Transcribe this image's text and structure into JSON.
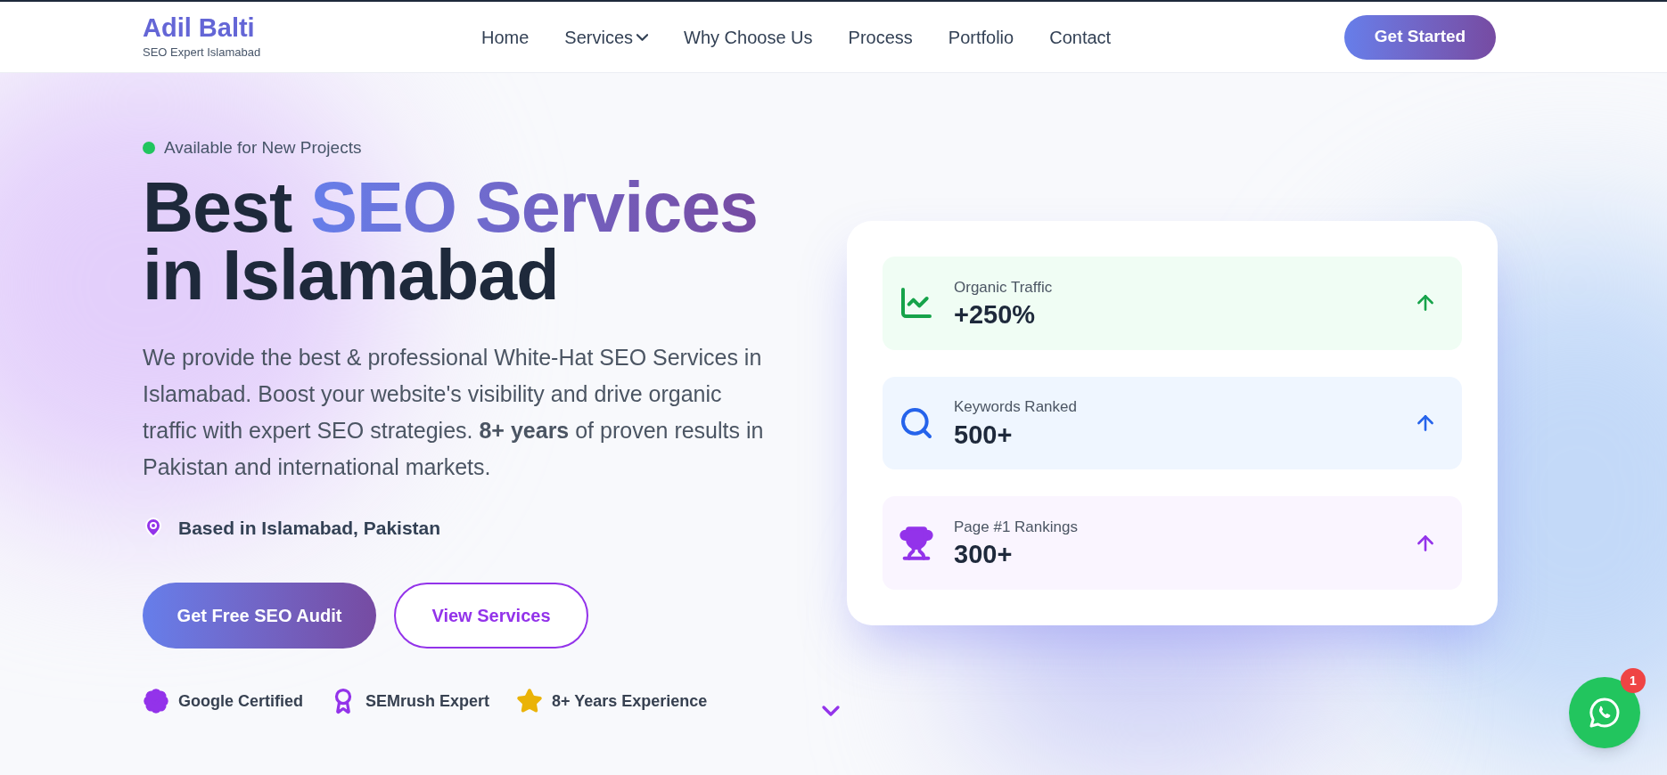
{
  "brand": {
    "name": "Adil Balti",
    "tagline": "SEO Expert Islamabad"
  },
  "nav": [
    {
      "label": "Home",
      "has_menu": false
    },
    {
      "label": "Services",
      "has_menu": true
    },
    {
      "label": "Why Choose Us",
      "has_menu": false
    },
    {
      "label": "Process",
      "has_menu": false
    },
    {
      "label": "Portfolio",
      "has_menu": false
    },
    {
      "label": "Contact",
      "has_menu": false
    }
  ],
  "header_button": "Get Started",
  "hero": {
    "status": {
      "text": "Available for New Projects",
      "available": true
    },
    "headline": {
      "lead": "Best",
      "highlight": "SEO Services",
      "tail": "in Islamabad"
    },
    "description": "We provide the best & professional White-Hat SEO Services in Islamabad. Boost your website's visibility and drive organic traffic with expert SEO strategies. **8+ years** of proven results in Pakistan and international markets.",
    "location": "Based in Islamabad, Pakistan",
    "buttons": [
      {
        "label": "Get Free SEO Audit",
        "kind": "primary"
      },
      {
        "label": "View Services",
        "kind": "outline"
      }
    ],
    "badges": [
      {
        "label": "Google Certified",
        "kind": "seal"
      },
      {
        "label": "SEMrush Expert",
        "kind": "award"
      },
      {
        "label": "8+ Years Experience",
        "kind": "star"
      }
    ]
  },
  "stats": [
    {
      "label": "Organic Traffic",
      "value": "+250%",
      "kind": "chart",
      "color": "#16a34a"
    },
    {
      "label": "Keywords Ranked",
      "value": "500+",
      "kind": "search",
      "color": "#2563eb"
    },
    {
      "label": "Page #1 Rankings",
      "value": "300+",
      "kind": "trophy",
      "color": "#9333ea"
    }
  ],
  "chat": {
    "unread": "1"
  }
}
